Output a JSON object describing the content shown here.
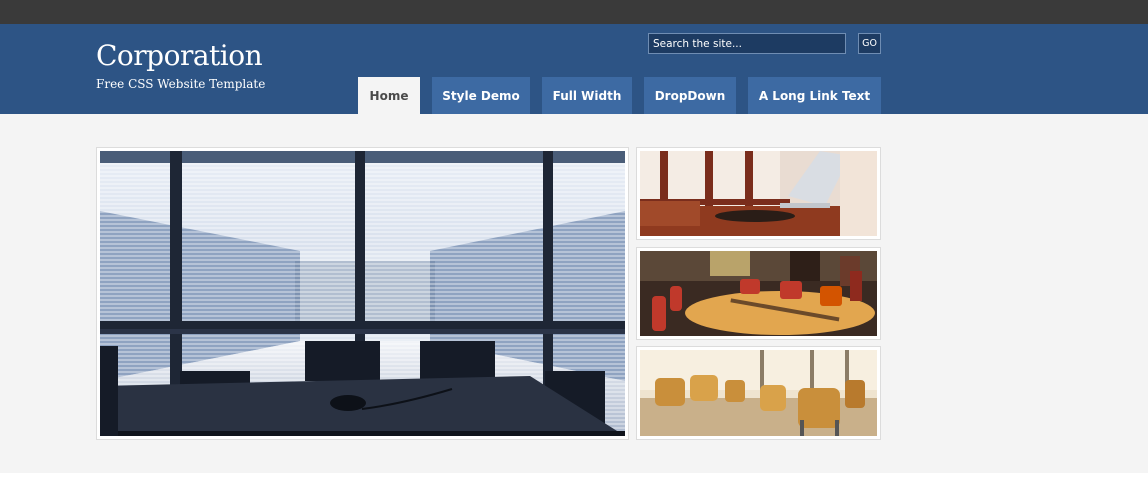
{
  "site": {
    "title": "Corporation",
    "tagline": "Free CSS Website Template"
  },
  "search": {
    "placeholder": "Search the site...",
    "button_label": "GO"
  },
  "nav": {
    "tabs": [
      {
        "label": "Home",
        "active": true
      },
      {
        "label": "Style Demo",
        "active": false
      },
      {
        "label": "Full Width",
        "active": false
      },
      {
        "label": "DropDown",
        "active": false
      },
      {
        "label": "A Long Link Text",
        "active": false
      }
    ]
  },
  "gallery": {
    "main_image": "office-atrium-photo",
    "thumbnails": [
      "laptop-lounge-photo",
      "conference-room-photo",
      "cafeteria-chairs-photo"
    ]
  },
  "colors": {
    "topbar": "#3a3a3a",
    "header": "#2d5485",
    "nav_tab": "#3d6aa3",
    "content_bg": "#f4f4f4"
  }
}
